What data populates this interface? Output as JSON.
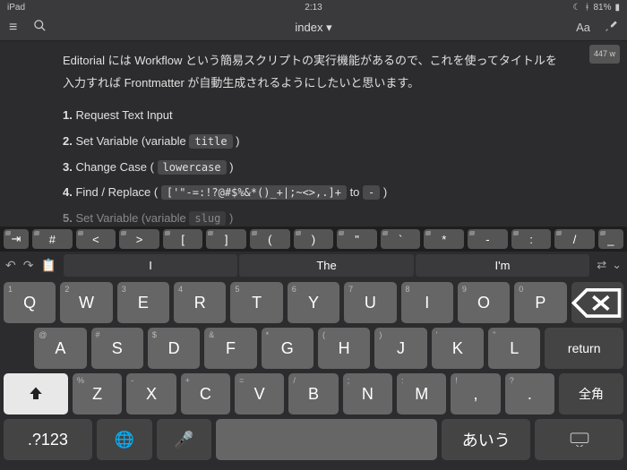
{
  "status": {
    "device": "iPad",
    "time": "2:13",
    "bt": "81%"
  },
  "toolbar": {
    "title": "index ▾",
    "aa": "Aa"
  },
  "editor": {
    "wordCount": "447 w",
    "para": "Editorial には Workflow という簡易スクリプトの実行機能があるので、これを使ってタイトルを入力すれば Frontmatter が自動生成されるようにしたいと思います。",
    "l1n": "1.",
    "l1t": "Request Text Input",
    "l2n": "2.",
    "l2a": "Set Variable (variable",
    "l2c": "title",
    "l2b": ")",
    "l3n": "3.",
    "l3a": "Change Case (",
    "l3c": "lowercase",
    "l3b": ")",
    "l4n": "4.",
    "l4a": "Find / Replace (",
    "l4c": "['\"-=:!?@#$%&*()_+|;~<>,.]+",
    "l4m": "to",
    "l4d": "-",
    "l4b": ")",
    "l5n": "5.",
    "l5a": "Set Variable (variable",
    "l5c": "slug",
    "l5b": ")"
  },
  "sym": [
    "⇥",
    "#",
    "<",
    ">",
    "[",
    "]",
    "(",
    ")",
    "\"",
    "`",
    "*",
    "-",
    ":",
    "/",
    "_"
  ],
  "pred": {
    "s1": "I",
    "s2": "The",
    "s3": "I'm"
  },
  "rows": {
    "r1": [
      [
        "1",
        "Q"
      ],
      [
        "2",
        "W"
      ],
      [
        "3",
        "E"
      ],
      [
        "4",
        "R"
      ],
      [
        "5",
        "T"
      ],
      [
        "6",
        "Y"
      ],
      [
        "7",
        "U"
      ],
      [
        "8",
        "I"
      ],
      [
        "9",
        "O"
      ],
      [
        "0",
        "P"
      ]
    ],
    "r2": [
      [
        "@",
        "A"
      ],
      [
        "#",
        "S"
      ],
      [
        "$",
        "D"
      ],
      [
        "&",
        "F"
      ],
      [
        "*",
        "G"
      ],
      [
        "(",
        "H"
      ],
      [
        ")",
        "J"
      ],
      [
        "'",
        "K"
      ],
      [
        "\"",
        "L"
      ]
    ],
    "r3": [
      [
        "%",
        "Z"
      ],
      [
        "-",
        "X"
      ],
      [
        "+",
        "C"
      ],
      [
        "=",
        "V"
      ],
      [
        "/",
        "B"
      ],
      [
        ";",
        "N"
      ],
      [
        ":",
        "M"
      ],
      [
        "!",
        ","
      ],
      [
        "?",
        "."
      ]
    ],
    "return": "return",
    "zenkaku": "全角",
    "numkey": ".?123",
    "aiu": "あいう"
  }
}
